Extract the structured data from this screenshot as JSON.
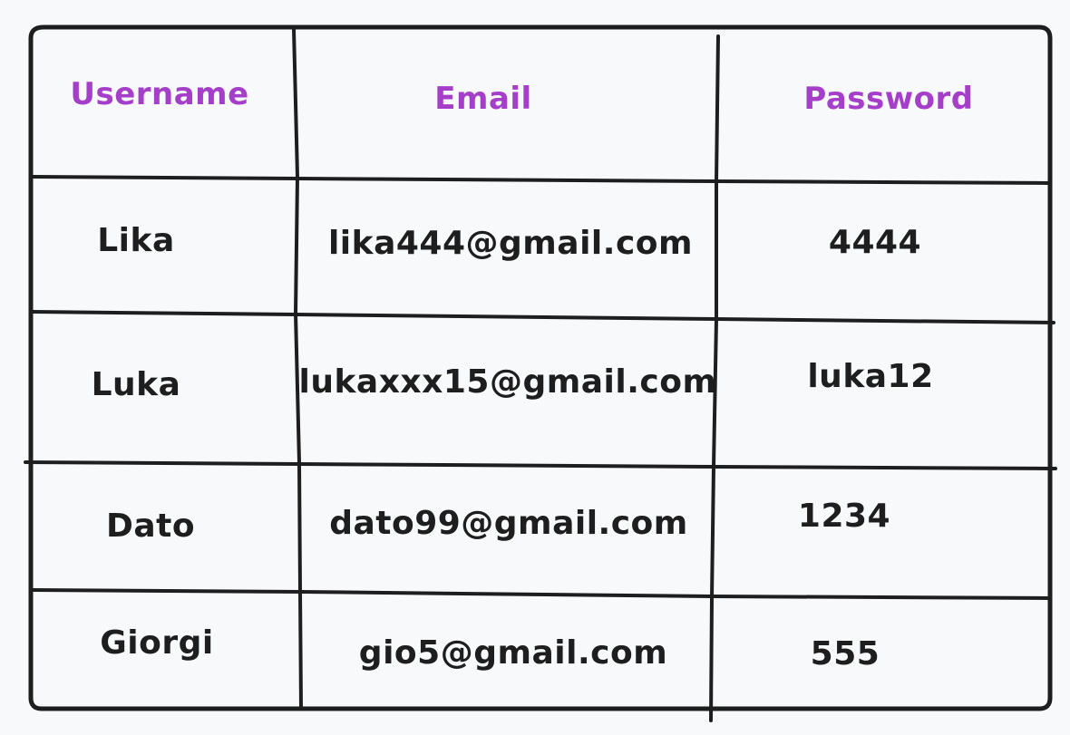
{
  "table": {
    "headers": [
      "Username",
      "Email",
      "Password"
    ],
    "rows": [
      [
        "Lika",
        "lika444@gmail.com",
        "4444"
      ],
      [
        "Luka",
        "lukaxxx15@gmail.com",
        "luka12"
      ],
      [
        "Dato",
        "dato99@gmail.com",
        "1234"
      ],
      [
        "Giorgi",
        "gio5@gmail.com",
        "555"
      ]
    ]
  },
  "colors": {
    "header_text": "#a53fc9",
    "body_text": "#1e1e1e",
    "grid_line": "#1e1e1e",
    "background": "#f8f9fb"
  }
}
